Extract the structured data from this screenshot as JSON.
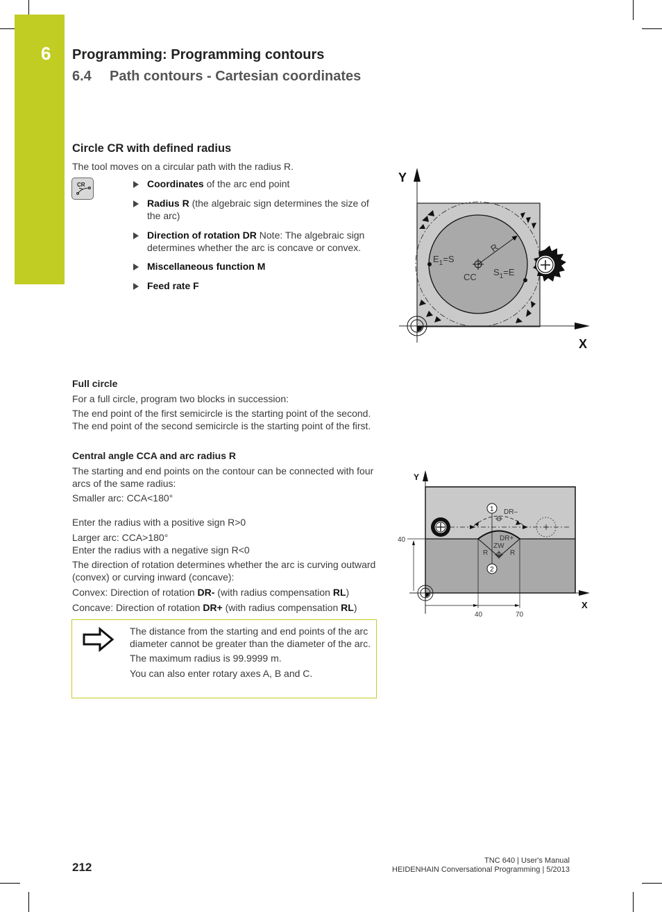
{
  "header": {
    "chapter_number": "6",
    "chapter_title": "Programming: Programming contours",
    "section_number": "6.4",
    "section_title": "Path contours - Cartesian coordinates"
  },
  "section": {
    "title": "Circle CR with defined radius",
    "intro": "The tool moves on a circular path with the radius R.",
    "key_icon": {
      "name": "cr-key-icon",
      "label": "CR"
    },
    "bullets": [
      {
        "bold": "Coordinates",
        "text": " of the arc end point"
      },
      {
        "bold": "Radius R",
        "text": " (the algebraic sign determines the size of the arc)"
      },
      {
        "bold": "Direction of rotation DR",
        "text": " Note: The algebraic sign determines whether the arc is concave or convex."
      },
      {
        "bold": "Miscellaneous function M",
        "text": ""
      },
      {
        "bold": "Feed rate F",
        "text": ""
      }
    ]
  },
  "figure1": {
    "axis_y": "Y",
    "axis_x": "X",
    "label_r": "R",
    "label_e1_main": "E",
    "label_e1_sub": "1",
    "label_e1_rest": "=S",
    "label_cc": "CC",
    "label_s1_main": "S",
    "label_s1_sub": "1",
    "label_s1_rest": "=E"
  },
  "full_circle": {
    "heading": "Full circle",
    "p1": "For a full circle, program two blocks in succession:",
    "p2": "The end point of the first semicircle is the starting point of the second. The end point of the second semicircle is the starting point of the first."
  },
  "central_angle": {
    "heading": "Central angle CCA and arc radius R",
    "p1": "The starting and end points on the contour can be connected with four arcs of the same radius:",
    "p2": "Smaller arc: CCA<180°",
    "p3": "Enter the radius with a positive sign R>0",
    "p4a": "Larger arc: CCA>180°",
    "p4b": "Enter the radius with a negative sign R<0",
    "p5": "The direction of rotation determines whether the arc is curving outward (convex) or curving inward (concave):",
    "convex_pre": "Convex: Direction of rotation ",
    "convex_dr": "DR-",
    "convex_mid": " (with radius compensation ",
    "convex_rl": "RL",
    "convex_post": ")",
    "concave_pre": "Concave: Direction of rotation ",
    "concave_dr": "DR+",
    "concave_mid": " (with radius compensation ",
    "concave_rl": "RL",
    "concave_post": ")"
  },
  "figure2": {
    "axis_y": "Y",
    "axis_x": "X",
    "label_40_y": "40",
    "label_40_x": "40",
    "label_70_x": "70",
    "marker_1": "1",
    "marker_2": "2",
    "label_dr_minus": "DR–",
    "label_dr_plus": "DR+",
    "label_zw": "ZW",
    "label_r_left": "R",
    "label_r_right": "R"
  },
  "note": {
    "icon": "arrow-right-icon",
    "lines": [
      "The distance from the starting and end points of the arc diameter cannot be greater than the diameter of the arc.",
      "The maximum radius is 99.9999 m.",
      "You can also enter rotary axes A, B and C."
    ]
  },
  "footer": {
    "page_number": "212",
    "line1": "TNC 640 | User's Manual",
    "line2": "HEIDENHAIN Conversational Programming | 5/2013"
  },
  "colors": {
    "accent": "#c2cd23",
    "figure_light": "#c9c9c9",
    "figure_dark": "#a9a9a9"
  }
}
